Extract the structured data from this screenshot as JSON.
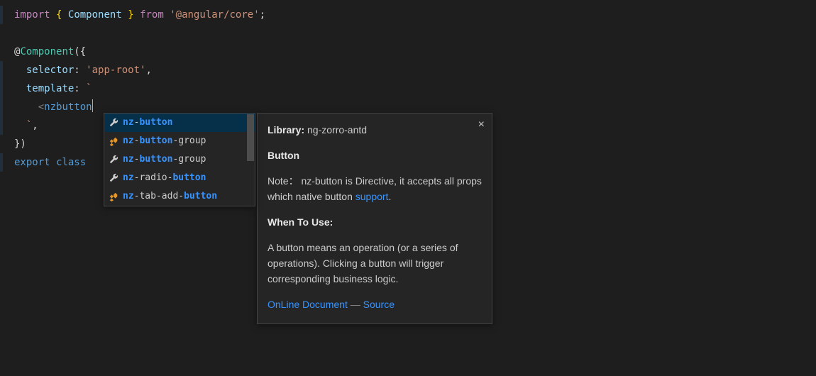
{
  "code": {
    "l1": {
      "kw_import": "import",
      "brace_open": "{",
      "ident": "Component",
      "brace_close": "}",
      "kw_from": "from",
      "str": "'@angular/core'",
      "semi": ";"
    },
    "l3": {
      "at": "@",
      "decorator": "Component",
      "open": "({"
    },
    "l4": {
      "prop": "selector",
      "colon": ":",
      "val": "'app-root'",
      "comma": ","
    },
    "l5": {
      "prop": "template",
      "colon": ":",
      "tick": "`"
    },
    "l6": {
      "lt": "<",
      "tagname": "nzbutton"
    },
    "l7": {
      "tick": "`",
      "comma": ","
    },
    "l8": {
      "close": "})"
    },
    "l9": {
      "kw_export": "export",
      "kw_class": "class"
    }
  },
  "suggestions": [
    {
      "icon": "wrench",
      "hl": "nz",
      "dim1": "-",
      "bold1": "button",
      "tail": "",
      "selected": true
    },
    {
      "icon": "cls",
      "hl": "nz",
      "dim1": "-",
      "bold1": "button",
      "tail": "-group",
      "selected": false
    },
    {
      "icon": "wrench",
      "hl": "nz",
      "dim1": "-",
      "bold1": "button",
      "tail": "-group",
      "selected": false
    },
    {
      "icon": "wrench",
      "hl": "nz",
      "dim1": "-radio-",
      "bold1": "button",
      "tail": "",
      "selected": false
    },
    {
      "icon": "cls",
      "hl": "nz",
      "dim1": "-tab-add-",
      "bold1": "button",
      "tail": "",
      "selected": false
    }
  ],
  "doc": {
    "library_label": "Library:",
    "library_value": "ng-zorro-antd",
    "heading": "Button",
    "note_prefix": "Note：",
    "note_body_a": "nz-button is Directive, it accepts all props which native button ",
    "note_link": "support",
    "note_dot": ".",
    "when_label": "When To Use:",
    "when_body": "A button means an operation (or a series of operations). Clicking a button will trigger corresponding business logic.",
    "link_online": "OnLine Document",
    "dash": "—",
    "link_source": "Source",
    "close_glyph": "×"
  }
}
